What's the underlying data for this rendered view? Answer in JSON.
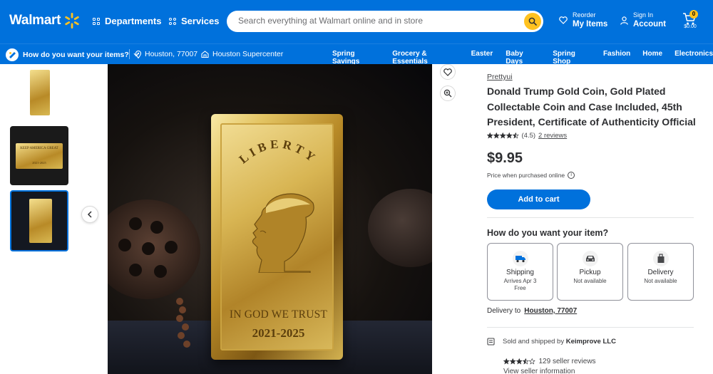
{
  "header": {
    "logo_text": "Walmart",
    "departments_label": "Departments",
    "services_label": "Services",
    "search_placeholder": "Search everything at Walmart online and in store",
    "reorder_small": "Reorder",
    "reorder_big": "My Items",
    "signin_small": "Sign In",
    "signin_big": "Account",
    "cart_count": "0",
    "cart_total": "$0.00",
    "brand_color": "#0071dc",
    "accent_color": "#ffc220"
  },
  "subnav": {
    "fulfillment_prompt": "How do you want your items?",
    "location": "Houston, 77007",
    "store": "Houston Supercenter",
    "categories": [
      "Spring Savings",
      "Grocery & Essentials",
      "Easter",
      "Baby Days",
      "Spring Shop",
      "Fashion",
      "Home",
      "Electronics"
    ]
  },
  "gallery": {
    "selected_index": 2,
    "thumb2_caption": "KEEP AMERICA GREAT",
    "thumb_years": "2021-2025",
    "bar_top_text": "LIBERTY",
    "bar_motto": "IN GOD WE TRUST",
    "bar_years": "2021-2025"
  },
  "product": {
    "brand": "Prettyui",
    "title": "Donald Trump Gold Coin, Gold Plated Collectable Coin and Case Included, 45th President, Certificate of Authenticity Official",
    "rating_value": 4.5,
    "rating_text": "(4.5)",
    "review_count_text": "2 reviews",
    "price": "$9.95",
    "price_note": "Price when purchased online",
    "add_to_cart_label": "Add to cart"
  },
  "fulfillment": {
    "title": "How do you want your item?",
    "options": [
      {
        "label": "Shipping",
        "line1": "Arrives Apr 3",
        "line2": "Free",
        "icon": "shipping-truck-icon"
      },
      {
        "label": "Pickup",
        "line1": "Not available",
        "line2": "",
        "icon": "pickup-car-icon"
      },
      {
        "label": "Delivery",
        "line1": "Not available",
        "line2": "",
        "icon": "delivery-bag-icon"
      }
    ],
    "delivery_prefix": "Delivery to",
    "delivery_location": "Houston, 77007"
  },
  "seller": {
    "sold_prefix": "Sold and shipped by",
    "name": "Keimprove LLC",
    "rating_value": 3.5,
    "reviews_text": "129 seller reviews",
    "view_label": "View seller information"
  }
}
